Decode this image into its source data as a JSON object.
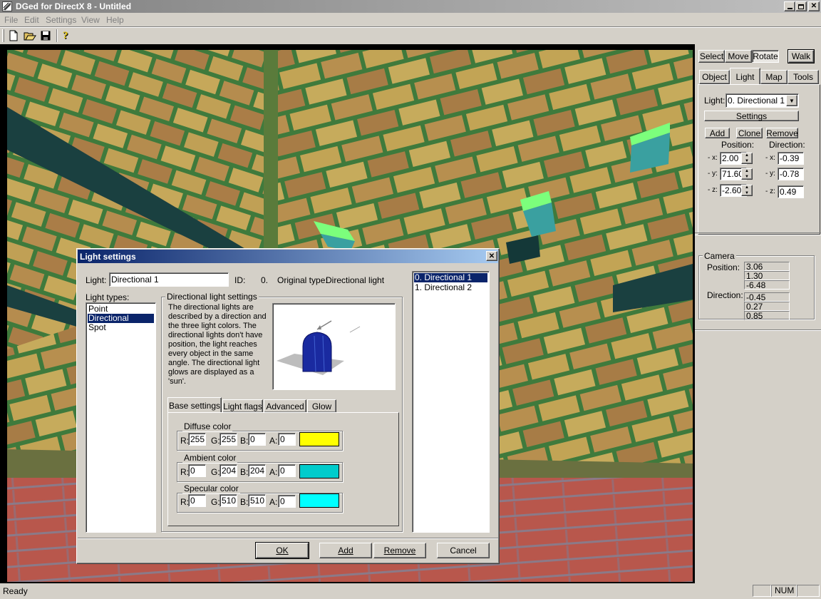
{
  "window": {
    "title": "DGed for DirectX 8 - Untitled"
  },
  "menu": [
    "File",
    "Edit",
    "Settings",
    "View",
    "Help"
  ],
  "toolbar": {
    "icons": [
      "new-icon",
      "open-icon",
      "save-icon",
      "help-icon"
    ]
  },
  "panel": {
    "modes": [
      "Select",
      "Move",
      "Rotate",
      "Walk"
    ],
    "tabs": [
      "Object",
      "Light",
      "Map",
      "Tools"
    ],
    "light_label": "Light:",
    "light_selected": "0. Directional 1",
    "settings_button": "Settings",
    "buttons": [
      "Add",
      "Clone",
      "Remove"
    ],
    "position_label": "Position:",
    "direction_label": "Direction:",
    "axes": [
      "- x:",
      "- y:",
      "- z:"
    ],
    "position": [
      "2.00",
      "71.60",
      "-2.60"
    ],
    "direction": [
      "-0.39",
      "-0.78",
      "0.49"
    ]
  },
  "camera": {
    "title": "Camera",
    "position_label": "Position:",
    "direction_label": "Direction:",
    "position": [
      "3.06",
      "1.30",
      "-6.48"
    ],
    "direction": [
      "-0.45",
      "0.27",
      "0.85"
    ]
  },
  "dialog": {
    "title": "Light settings",
    "light_label": "Light:",
    "light_name": "Directional 1",
    "id_label": "ID:",
    "id_value": "0.",
    "original_type_label": "Original type:",
    "original_type_value": "Directional light",
    "light_types_label": "Light types:",
    "light_types": [
      "Point",
      "Directional",
      "Spot"
    ],
    "group_title": "Directional light settings",
    "description": "The directional lights are described by a direction and the three light colors. The directional lights don't have position, the light reaches every object in the same angle. The directional light glows are displayed as a 'sun'.",
    "tabs": [
      "Base settings",
      "Light flags",
      "Advanced",
      "Glow"
    ],
    "colors": [
      {
        "label": "Diffuse color",
        "r": "255",
        "g": "255",
        "b": "0",
        "a": "0",
        "swatch": "#ffff00"
      },
      {
        "label": "Ambient color",
        "r": "0",
        "g": "204",
        "b": "204",
        "a": "0",
        "swatch": "#00cccc"
      },
      {
        "label": "Specular color",
        "r": "0",
        "g": "510",
        "b": "510",
        "a": "0",
        "swatch": "#00ffff"
      }
    ],
    "channel_labels": [
      "R:",
      "G:",
      "B:",
      "A:"
    ],
    "lights_list": [
      "0. Directional 1",
      "1. Directional 2"
    ],
    "buttons": {
      "ok": "OK",
      "add": "Add",
      "remove": "Remove",
      "cancel": "Cancel"
    }
  },
  "status": {
    "text": "Ready",
    "num": "NUM"
  }
}
